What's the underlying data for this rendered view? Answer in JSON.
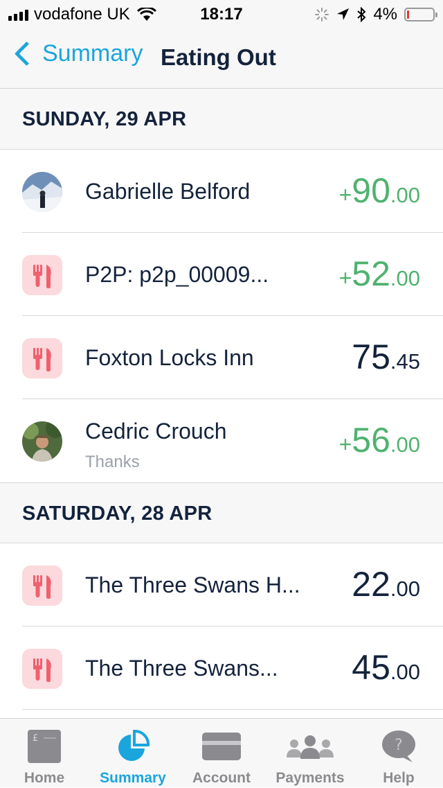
{
  "status_bar": {
    "carrier": "vodafone UK",
    "time": "18:17",
    "battery": "4%"
  },
  "nav": {
    "back_label": "Summary",
    "title": "Eating Out"
  },
  "sections": [
    {
      "header": "SUNDAY, 29 APR",
      "items": [
        {
          "name": "Gabrielle Belford",
          "note": "",
          "sign": "+",
          "major": "90",
          "minor": ".00",
          "type": "credit",
          "icon": "avatar-photo"
        },
        {
          "name": "P2P: p2p_00009...",
          "note": "",
          "sign": "+",
          "major": "52",
          "minor": ".00",
          "type": "credit",
          "icon": "eating-out-icon"
        },
        {
          "name": "Foxton Locks Inn",
          "note": "",
          "sign": "",
          "major": "75",
          "minor": ".45",
          "type": "debit",
          "icon": "eating-out-icon"
        },
        {
          "name": "Cedric Crouch",
          "note": "Thanks",
          "sign": "+",
          "major": "56",
          "minor": ".00",
          "type": "credit",
          "icon": "avatar-photo"
        }
      ]
    },
    {
      "header": "SATURDAY, 28 APR",
      "items": [
        {
          "name": "The Three Swans H...",
          "note": "",
          "sign": "",
          "major": "22",
          "minor": ".00",
          "type": "debit",
          "icon": "eating-out-icon"
        },
        {
          "name": "The Three Swans...",
          "note": "",
          "sign": "",
          "major": "45",
          "minor": ".00",
          "type": "debit",
          "icon": "eating-out-icon"
        }
      ]
    }
  ],
  "tabs": [
    {
      "label": "Home",
      "icon": "home-icon"
    },
    {
      "label": "Summary",
      "icon": "pie-chart-icon"
    },
    {
      "label": "Account",
      "icon": "card-icon"
    },
    {
      "label": "Payments",
      "icon": "people-icon"
    },
    {
      "label": "Help",
      "icon": "help-icon"
    }
  ],
  "active_tab": "Summary",
  "colors": {
    "accent": "#1aa5dd",
    "credit": "#4fb26f",
    "category_bg": "#fcd9dc",
    "category_fg": "#f0606e"
  }
}
